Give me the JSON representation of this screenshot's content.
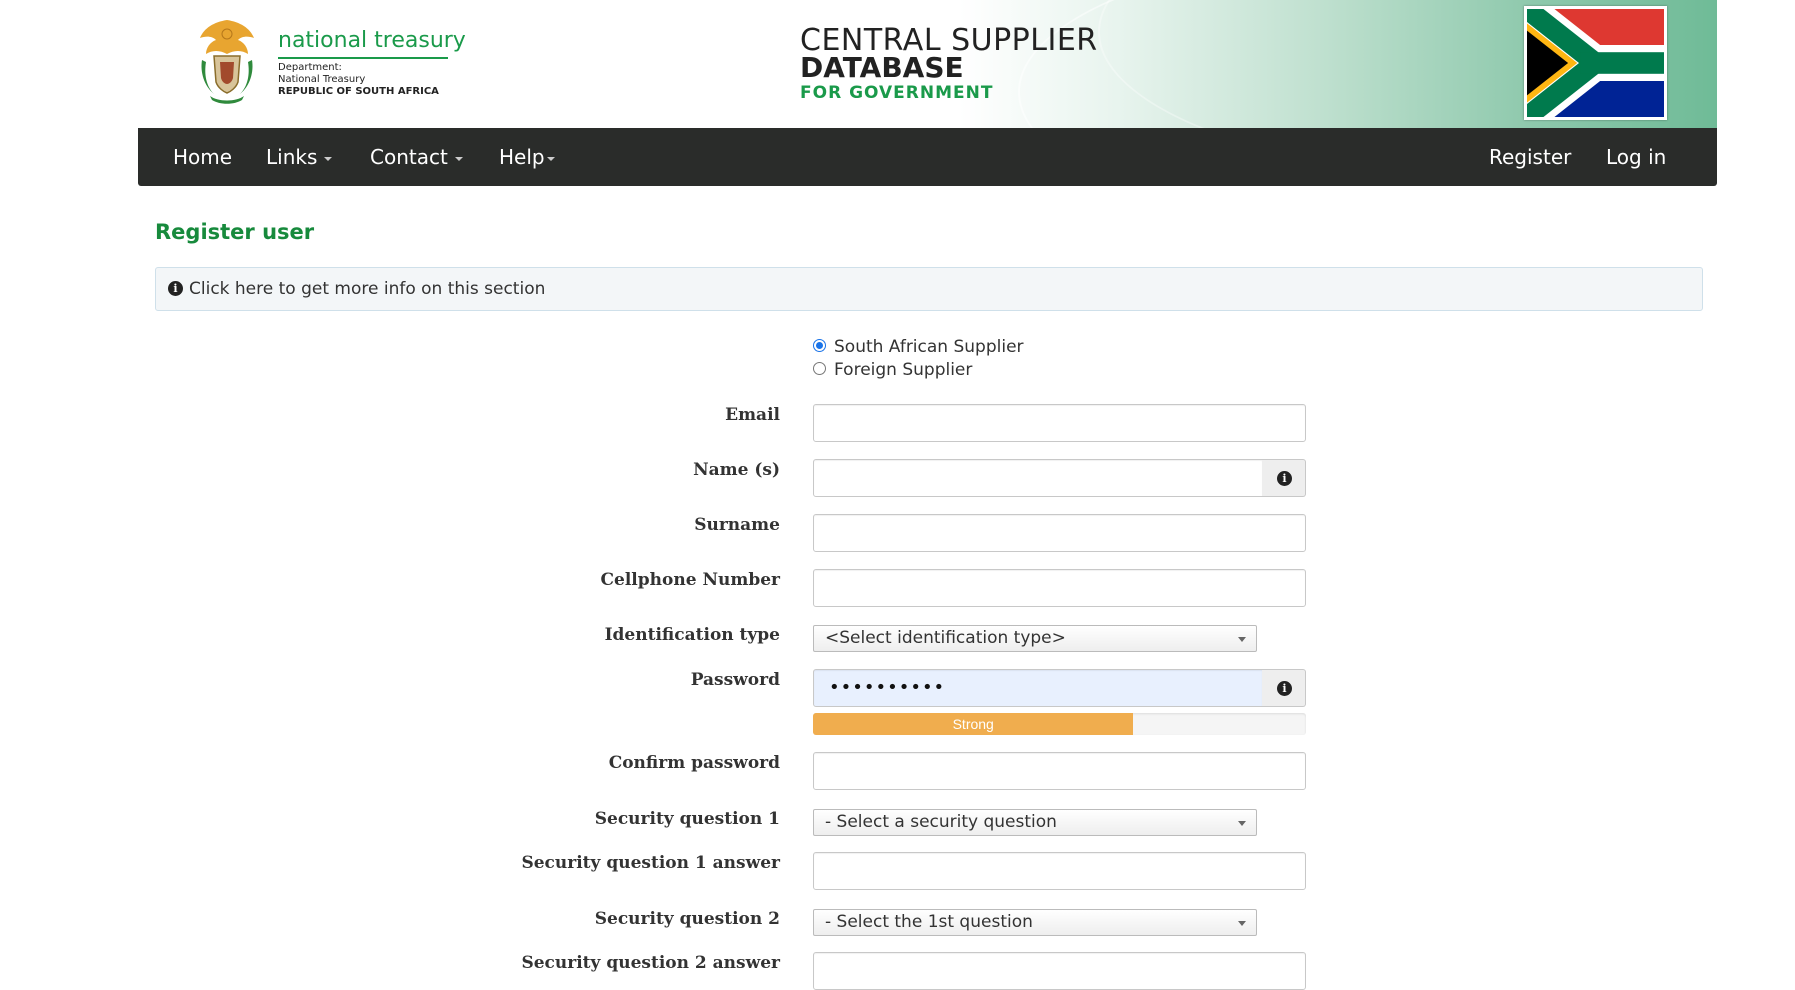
{
  "header": {
    "org_name": "national treasury",
    "org_dept_line1": "Department:",
    "org_dept_line2": "National Treasury",
    "org_dept_line3": "REPUBLIC OF SOUTH AFRICA",
    "title_line1": "CENTRAL SUPPLIER",
    "title_line2": "DATABASE",
    "title_line3": "FOR GOVERNMENT",
    "brand_green": "#1a9a4a"
  },
  "nav": {
    "left": [
      {
        "label": "Home",
        "dropdown": false
      },
      {
        "label": "Links",
        "dropdown": true
      },
      {
        "label": "Contact",
        "dropdown": true
      },
      {
        "label": "Help",
        "dropdown": true
      }
    ],
    "right": [
      {
        "label": "Register"
      },
      {
        "label": "Log in"
      }
    ]
  },
  "page": {
    "title": "Register user",
    "info_text": "Click here to get more info on this section",
    "info_icon": "info-circle-icon"
  },
  "form": {
    "supplier_type": {
      "options": [
        "South African Supplier",
        "Foreign Supplier"
      ],
      "selected": "South African Supplier"
    },
    "email": {
      "label": "Email",
      "value": ""
    },
    "names": {
      "label": "Name (s)",
      "value": "",
      "help_icon": "info-circle-icon"
    },
    "surname": {
      "label": "Surname",
      "value": ""
    },
    "cellphone": {
      "label": "Cellphone Number",
      "value": ""
    },
    "id_type": {
      "label": "Identification type",
      "selected": "<Select identification type>"
    },
    "password": {
      "label": "Password",
      "masked_value": "••••••••••",
      "help_icon": "info-circle-icon"
    },
    "strength": {
      "label": "Strong",
      "percent": 65,
      "color": "#f0ad4e"
    },
    "confirm_password": {
      "label": "Confirm password",
      "value": ""
    },
    "sq1": {
      "label": "Security question 1",
      "selected": "- Select a security question"
    },
    "sq1_answer": {
      "label": "Security question 1 answer",
      "value": ""
    },
    "sq2": {
      "label": "Security question 2",
      "selected": "- Select the 1st question"
    },
    "sq2_answer": {
      "label": "Security question 2 answer",
      "value": ""
    }
  }
}
